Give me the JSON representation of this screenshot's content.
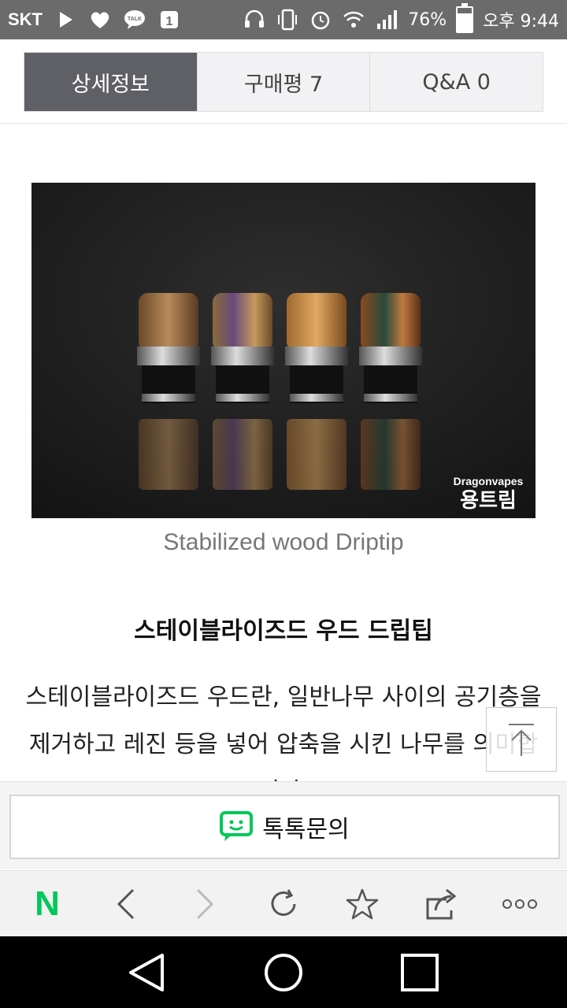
{
  "status_bar": {
    "carrier": "SKT",
    "battery": "76%",
    "battery_level": 0.76,
    "time": "오후 9:44",
    "icons": [
      "play-icon",
      "heart-icon",
      "kakaotalk-icon",
      "notification-badge-icon",
      "headset-icon",
      "vibrate-icon",
      "alarm-icon",
      "wifi-icon",
      "signal-icon",
      "battery-icon"
    ]
  },
  "tabs": [
    {
      "label": "상세정보",
      "active": true
    },
    {
      "label": "구매평 7",
      "active": false
    },
    {
      "label": "Q&A 0",
      "active": false
    }
  ],
  "product": {
    "image_watermark_1": "Dragonvapes",
    "image_watermark_2": "용트림",
    "caption": "Stabilized wood Driptip",
    "heading": "스테이블라이즈드 우드 드립팁",
    "body": "스테이블라이즈드 우드란, 일반나무 사이의 공기층을 제거하고 레진 등을 넣어 압축을 시킨 나무를 의미합니다."
  },
  "talk_button": {
    "label": "톡톡문의",
    "icon": "talktalk-icon"
  },
  "toolbar": {
    "icons": [
      "naver-icon",
      "back-icon",
      "forward-icon",
      "refresh-icon",
      "bookmark-star-icon",
      "share-icon",
      "more-icon"
    ],
    "naver_label": "N"
  },
  "nav": {
    "icons": [
      "back-triangle-icon",
      "home-circle-icon",
      "recents-square-icon"
    ]
  },
  "colors": {
    "accent_green": "#03c75a",
    "tab_active_bg": "#5f6066",
    "status_bar_bg": "#6b6b6b"
  }
}
